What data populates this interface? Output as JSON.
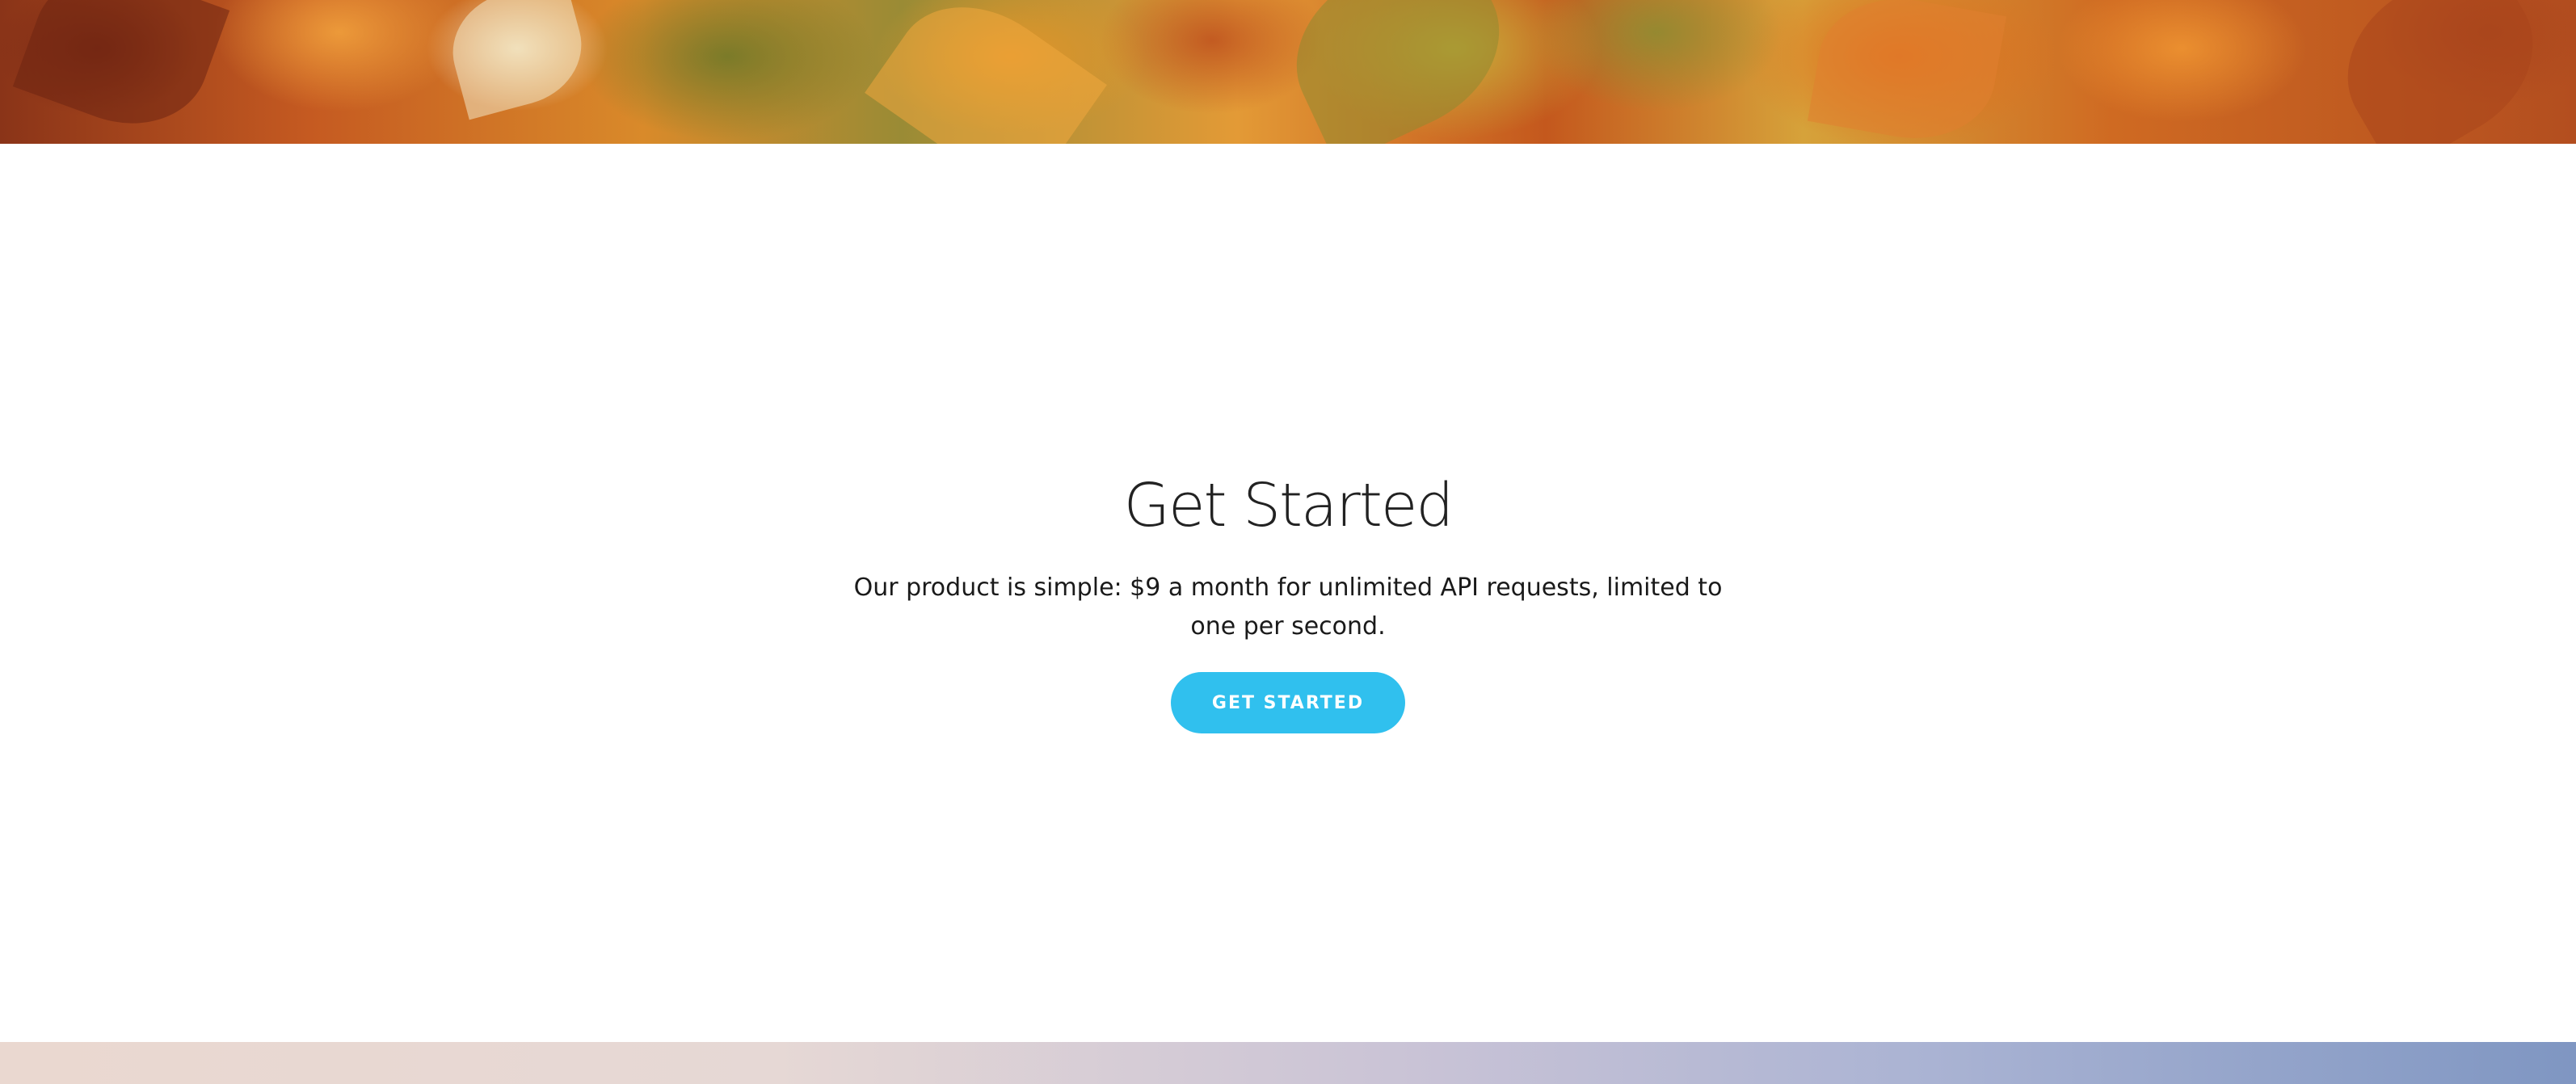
{
  "get_started": {
    "title": "Get Started",
    "description": "Our product is simple: $9 a month for unlimited API requests, limited to one per second.",
    "button_label": "GET STARTED"
  },
  "colors": {
    "accent": "#30c0ee",
    "heading": "#222222",
    "body_text": "#1a1a1a",
    "background": "#ffffff"
  },
  "images": {
    "top_banner": "autumn-leaves-photo",
    "bottom_banner": "sunset-sky-photo"
  }
}
